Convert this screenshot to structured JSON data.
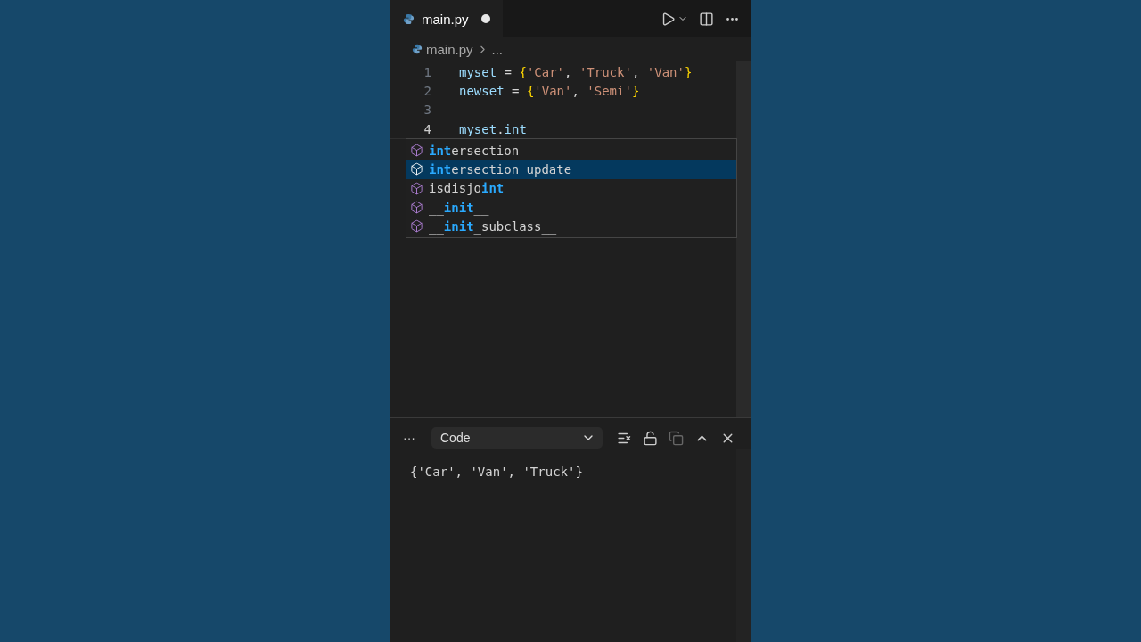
{
  "tab": {
    "title": "main.py",
    "dirty": true
  },
  "breadcrumb": {
    "file": "main.py",
    "rest": "..."
  },
  "code_lines": [
    {
      "number": "1",
      "active": false,
      "tokens": [
        {
          "kind": "var",
          "text": "myset"
        },
        {
          "kind": "op",
          "text": " = "
        },
        {
          "kind": "brace",
          "text": "{"
        },
        {
          "kind": "str",
          "text": "'Car'"
        },
        {
          "kind": "op",
          "text": ", "
        },
        {
          "kind": "str",
          "text": "'Truck'"
        },
        {
          "kind": "op",
          "text": ", "
        },
        {
          "kind": "str",
          "text": "'Van'"
        },
        {
          "kind": "brace",
          "text": "}"
        }
      ]
    },
    {
      "number": "2",
      "active": false,
      "tokens": [
        {
          "kind": "var",
          "text": "newset"
        },
        {
          "kind": "op",
          "text": " = "
        },
        {
          "kind": "brace",
          "text": "{"
        },
        {
          "kind": "str",
          "text": "'Van'"
        },
        {
          "kind": "op",
          "text": ", "
        },
        {
          "kind": "str",
          "text": "'Semi'"
        },
        {
          "kind": "brace",
          "text": "}"
        }
      ]
    },
    {
      "number": "3",
      "active": false
    },
    {
      "number": "4",
      "active": true,
      "tokens": [
        {
          "kind": "var",
          "text": "myset"
        },
        {
          "kind": "op",
          "text": "."
        },
        {
          "kind": "var",
          "text": "int"
        }
      ]
    }
  ],
  "suggestions": [
    {
      "selected": false,
      "parts": [
        {
          "text": "int",
          "match": true
        },
        {
          "text": "ersection",
          "match": false
        }
      ]
    },
    {
      "selected": true,
      "parts": [
        {
          "text": "int",
          "match": true
        },
        {
          "text": "ersection_update",
          "match": false
        }
      ]
    },
    {
      "selected": false,
      "parts": [
        {
          "text": "isdisjo",
          "match": false
        },
        {
          "text": "int",
          "match": true
        }
      ]
    },
    {
      "selected": false,
      "parts": [
        {
          "text": "__",
          "match": false
        },
        {
          "text": "init",
          "match": true
        },
        {
          "text": "__",
          "match": false
        }
      ]
    },
    {
      "selected": false,
      "parts": [
        {
          "text": "__",
          "match": false
        },
        {
          "text": "init",
          "match": true
        },
        {
          "text": "_subclass__",
          "match": false
        }
      ]
    }
  ],
  "panel": {
    "more": "···",
    "dropdown": "Code",
    "output": "{'Car', 'Van', 'Truck'}"
  }
}
